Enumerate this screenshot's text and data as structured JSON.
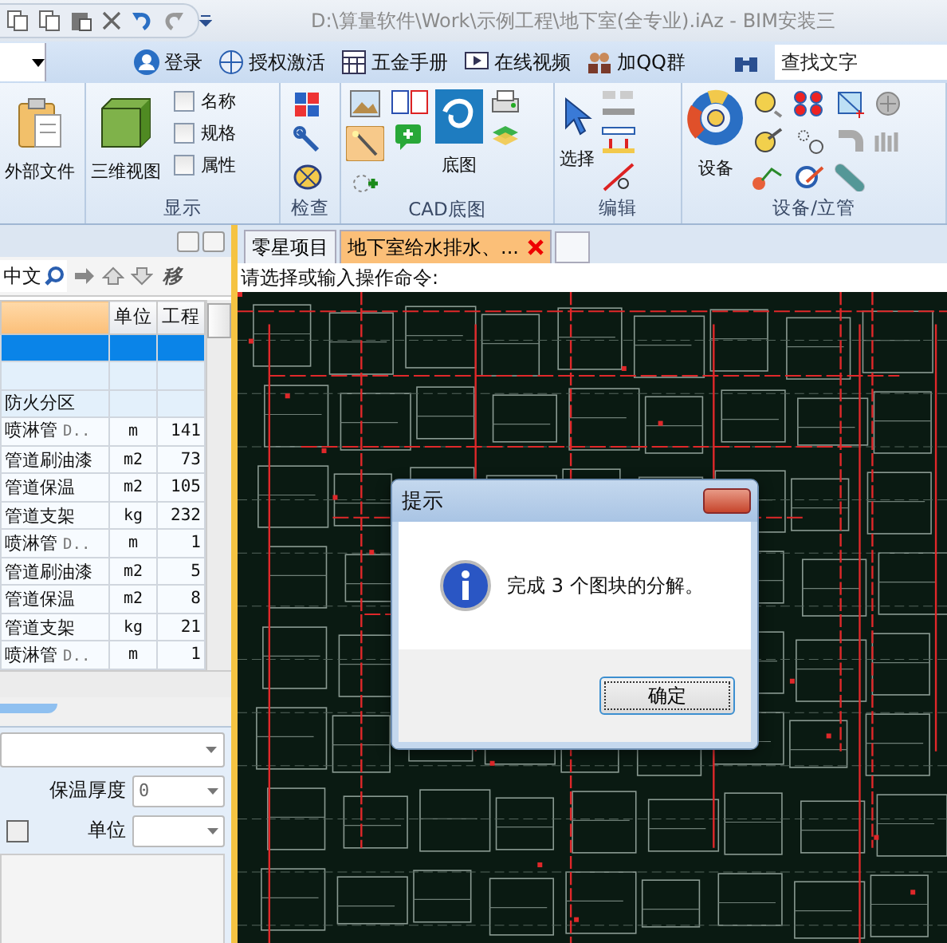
{
  "window": {
    "title": "D:\\算量软件\\Work\\示例工程\\地下室(全专业).iAz - BIM安装三"
  },
  "top_links": [
    {
      "label": "登录"
    },
    {
      "label": "授权激活"
    },
    {
      "label": "五金手册"
    },
    {
      "label": "在线视频"
    },
    {
      "label": "加QQ群"
    }
  ],
  "search": {
    "placeholder": "查找文字"
  },
  "ribbon": {
    "groups": [
      {
        "buttons": [
          "外部文件"
        ]
      },
      {
        "label": "显示",
        "buttons": [
          "三维视图"
        ],
        "checks": [
          {
            "label": "名称",
            "checked": false
          },
          {
            "label": "规格",
            "checked": false
          },
          {
            "label": "属性",
            "checked": false
          }
        ]
      },
      {
        "label": "检查"
      },
      {
        "label": "CAD底图",
        "buttons": [
          "底图"
        ]
      },
      {
        "label": "编辑",
        "buttons": [
          "选择"
        ]
      },
      {
        "label": "设备/立管",
        "buttons": [
          "设备"
        ]
      }
    ]
  },
  "left_panel": {
    "search": {
      "value": "中文"
    },
    "move_button": "移",
    "table": {
      "columns": [
        "单位",
        "工程"
      ],
      "rows": [
        {
          "selected": true
        },
        {
          "selected": false
        },
        {
          "name": "防火分区",
          "selected": false
        },
        {
          "name": "喷淋管",
          "spec": "D..",
          "unit": "m",
          "quantity": "141",
          "selected": false
        },
        {
          "name": "管道刷油漆",
          "unit": "m2",
          "quantity": "73",
          "selected": false
        },
        {
          "name": "管道保温",
          "unit": "m2",
          "quantity": "105",
          "selected": false
        },
        {
          "name": "管道支架",
          "unit": "kg",
          "quantity": "232",
          "selected": false
        },
        {
          "name": "喷淋管",
          "spec": "D..",
          "unit": "m",
          "quantity": "1",
          "selected": false
        },
        {
          "name": "管道刷油漆",
          "unit": "m2",
          "quantity": "5",
          "selected": false
        },
        {
          "name": "管道保温",
          "unit": "m2",
          "quantity": "8",
          "selected": false
        },
        {
          "name": "管道支架",
          "unit": "kg",
          "quantity": "21",
          "selected": false
        },
        {
          "name": "喷淋管",
          "spec": "D..",
          "unit": "m",
          "quantity": "1",
          "selected": false
        }
      ]
    },
    "properties": [
      {
        "label": "保温厚度",
        "value": "0"
      },
      {
        "label": "单位"
      }
    ]
  },
  "tabs": [
    {
      "label": "零星项目",
      "selected": false
    },
    {
      "label": "地下室给水排水、...",
      "selected": true
    }
  ],
  "command_prompt": "请选择或输入操作命令:",
  "dialog": {
    "title": "提示",
    "message": "完成 3 个图块的分解。",
    "button": "确定"
  }
}
